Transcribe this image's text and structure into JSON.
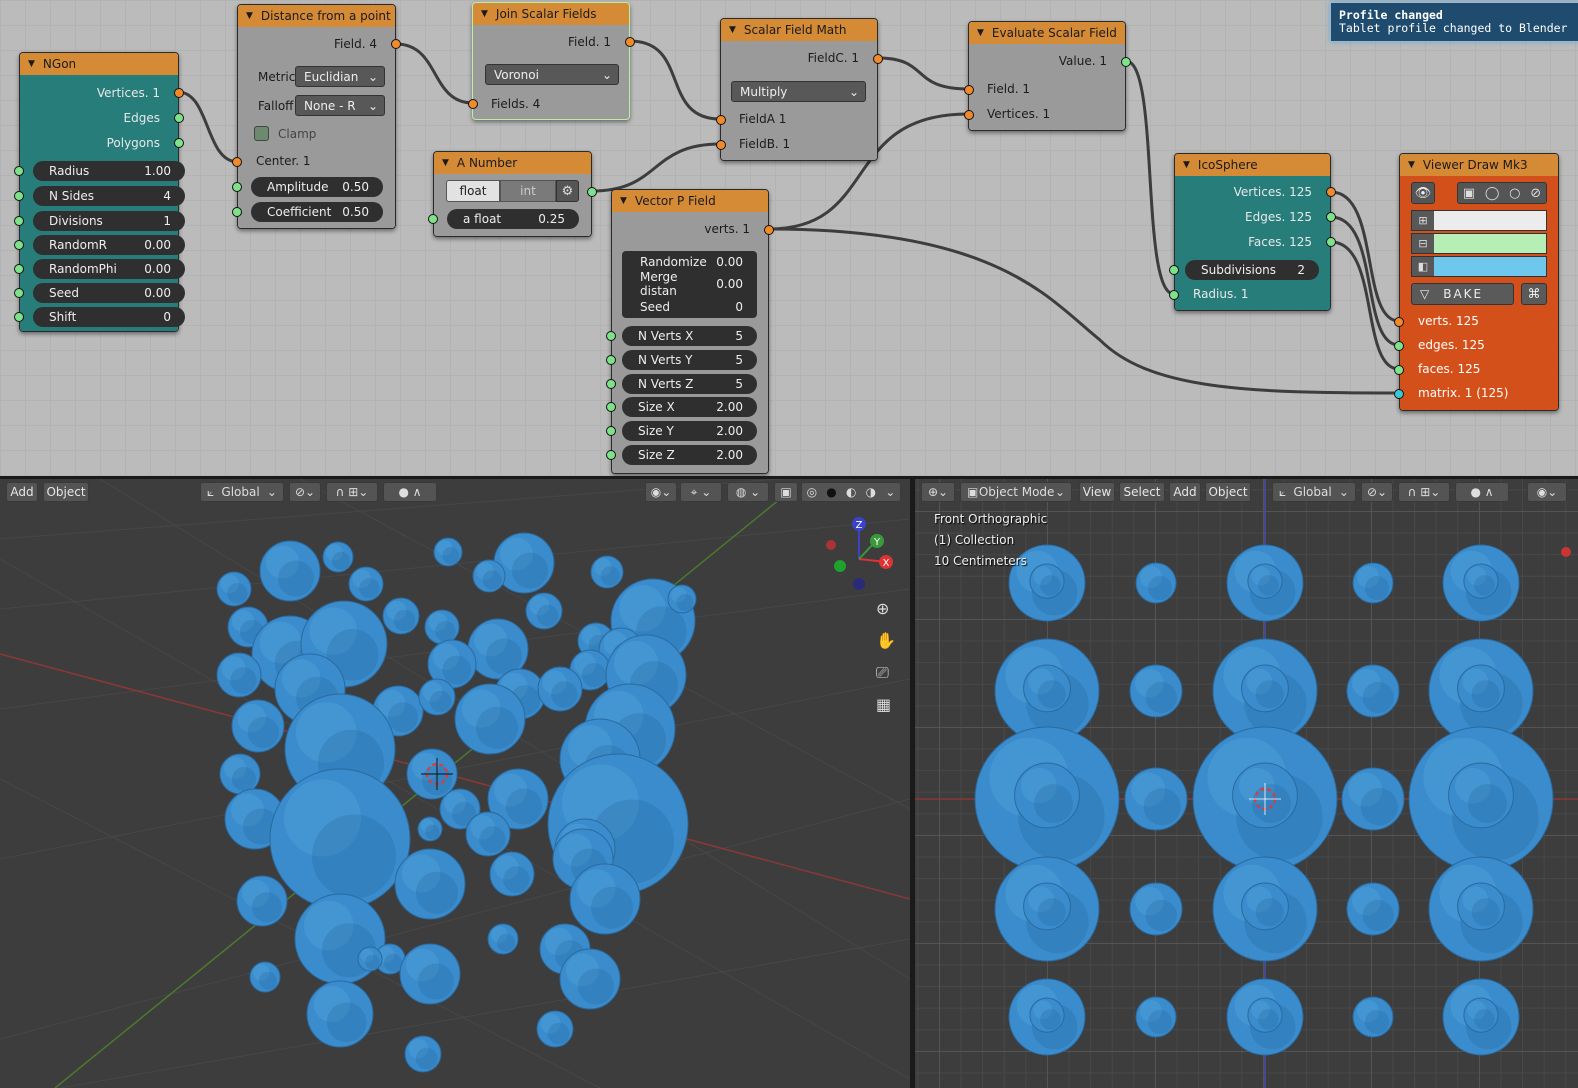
{
  "toast": {
    "title": "Profile changed",
    "message": "Tablet profile changed to Blender"
  },
  "nodes": {
    "ngon": {
      "title": "NGon",
      "outputs": [
        "Vertices. 1",
        "Edges",
        "Polygons"
      ],
      "fields": [
        [
          "Radius",
          "1.00"
        ],
        [
          "N Sides",
          "4"
        ],
        [
          "Divisions",
          "1"
        ],
        [
          "RandomR",
          "0.00"
        ],
        [
          "RandomPhi",
          "0.00"
        ],
        [
          "Seed",
          "0.00"
        ],
        [
          "Shift",
          "0"
        ]
      ]
    },
    "distance": {
      "title": "Distance from a point",
      "output": "Field. 4",
      "metric_label": "Metric:",
      "metric": "Euclidian",
      "falloff_label": "Falloff",
      "falloff": "None - R",
      "clamp": "Clamp",
      "center": "Center. 1",
      "fields": [
        [
          "Amplitude",
          "0.50"
        ],
        [
          "Coefficient",
          "0.50"
        ]
      ]
    },
    "join": {
      "title": "Join Scalar Fields",
      "output": "Field. 1",
      "mode": "Voronoi",
      "input": "Fields. 4"
    },
    "number": {
      "title": "A Number",
      "tab_float": "float",
      "tab_int": "int",
      "field": [
        "a float",
        "0.25"
      ]
    },
    "vpfield": {
      "title": "Vector P Field",
      "output": "verts. 1",
      "fields": [
        [
          "Randomize",
          "0.00"
        ],
        [
          "Merge distan",
          "0.00"
        ],
        [
          "Seed",
          "0"
        ],
        [
          "N Verts X",
          "5"
        ],
        [
          "N Verts Y",
          "5"
        ],
        [
          "N Verts Z",
          "5"
        ],
        [
          "Size X",
          "2.00"
        ],
        [
          "Size Y",
          "2.00"
        ],
        [
          "Size Z",
          "2.00"
        ]
      ]
    },
    "math": {
      "title": "Scalar Field Math",
      "output": "FieldC. 1",
      "op": "Multiply",
      "inputs": [
        "FieldA 1",
        "FieldB. 1"
      ]
    },
    "evaluate": {
      "title": "Evaluate Scalar Field",
      "output": "Value. 1",
      "inputs": [
        "Field. 1",
        "Vertices. 1"
      ]
    },
    "ico": {
      "title": "IcoSphere",
      "outputs": [
        "Vertices. 125",
        "Edges. 125",
        "Faces. 125"
      ],
      "field": [
        "Subdivisions",
        "2"
      ],
      "input": "Radius. 1"
    },
    "viewer": {
      "title": "Viewer Draw Mk3",
      "bake": "BAKE",
      "inputs": [
        "verts. 125",
        "edges. 125",
        "faces. 125",
        "matrix. 1 (125)"
      ],
      "colors": [
        "#ececec",
        "#b5efb5",
        "#6ec8ee"
      ]
    }
  },
  "left_header": {
    "add": "Add",
    "object": "Object",
    "orientation": "Global"
  },
  "right_header": {
    "mode": "Object Mode",
    "view": "View",
    "select": "Select",
    "add": "Add",
    "object": "Object",
    "orientation": "Global"
  },
  "right_overlay": {
    "line1": "Front Orthographic",
    "line2": "(1) Collection",
    "line3": "10 Centimeters"
  },
  "gizmo": {
    "x": "X",
    "y": "Y",
    "z": "Z"
  },
  "colors": {
    "sphere": "#3a8ccc",
    "node_header": "#d58a36",
    "teal": "#277d7a",
    "viewer": "#d4501a"
  }
}
